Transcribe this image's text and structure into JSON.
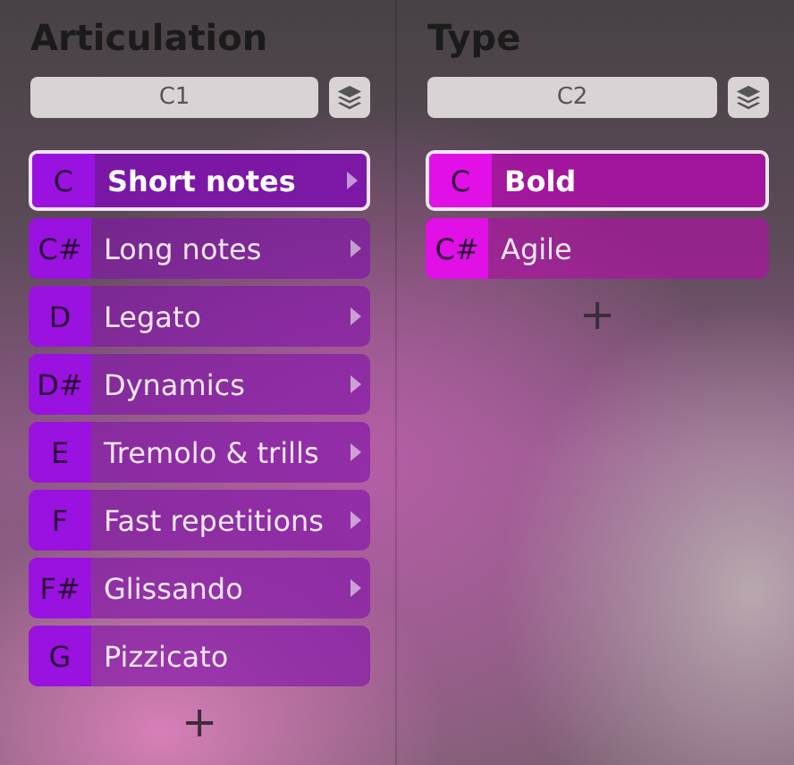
{
  "columns": [
    {
      "title": "Articulation",
      "channel": "C1",
      "color": "#9a12e0",
      "add": "+",
      "items": [
        {
          "key": "C",
          "label": "Short notes",
          "submenu": true,
          "selected": true
        },
        {
          "key": "C#",
          "label": "Long notes",
          "submenu": true,
          "selected": false
        },
        {
          "key": "D",
          "label": "Legato",
          "submenu": true,
          "selected": false
        },
        {
          "key": "D#",
          "label": "Dynamics",
          "submenu": true,
          "selected": false
        },
        {
          "key": "E",
          "label": "Tremolo & trills",
          "submenu": true,
          "selected": false
        },
        {
          "key": "F",
          "label": "Fast repetitions",
          "submenu": true,
          "selected": false
        },
        {
          "key": "F#",
          "label": "Glissando",
          "submenu": true,
          "selected": false
        },
        {
          "key": "G",
          "label": "Pizzicato",
          "submenu": false,
          "selected": false
        }
      ]
    },
    {
      "title": "Type",
      "channel": "C2",
      "color": "#e010e6",
      "add": "+",
      "items": [
        {
          "key": "C",
          "label": "Bold",
          "submenu": false,
          "selected": true
        },
        {
          "key": "C#",
          "label": "Agile",
          "submenu": false,
          "selected": false
        }
      ]
    }
  ]
}
